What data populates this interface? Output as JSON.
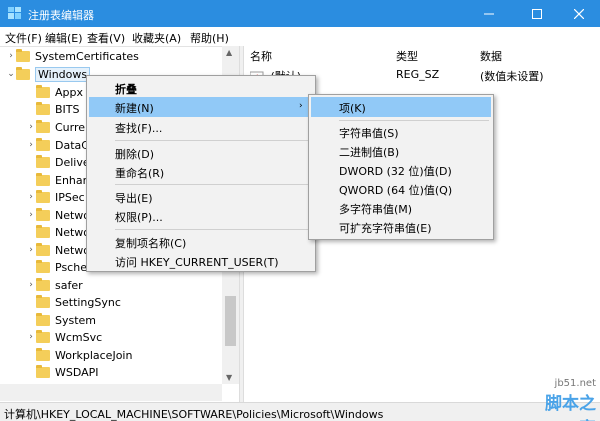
{
  "window": {
    "title": "注册表编辑器",
    "accent_color": "#2b8de0",
    "icons": {
      "app": "regedit-icon",
      "minimize": "minimize-icon",
      "maximize": "maximize-icon",
      "close": "close-icon"
    }
  },
  "menubar": {
    "items": [
      {
        "label": "文件(F)"
      },
      {
        "label": "编辑(E)"
      },
      {
        "label": "查看(V)"
      },
      {
        "label": "收藏夹(A)"
      },
      {
        "label": "帮助(H)"
      }
    ]
  },
  "tree": {
    "items": [
      {
        "label": "SystemCertificates",
        "expander": "›",
        "icon": "folder-icon"
      },
      {
        "label": "Windows",
        "expander": "⌄",
        "icon": "folder-icon",
        "selected": true
      },
      {
        "label": "Appx",
        "icon": "folder-icon"
      },
      {
        "label": "BITS",
        "icon": "folder-icon"
      },
      {
        "label": "Curre",
        "expander": "›",
        "icon": "folder-icon"
      },
      {
        "label": "DataC",
        "expander": "›",
        "icon": "folder-icon"
      },
      {
        "label": "Delive",
        "icon": "folder-icon"
      },
      {
        "label": "Enhar",
        "icon": "folder-icon"
      },
      {
        "label": "IPSec",
        "expander": "›",
        "icon": "folder-icon"
      },
      {
        "label": "Netwo",
        "expander": "›",
        "icon": "folder-icon"
      },
      {
        "label": "Netwo",
        "icon": "folder-icon"
      },
      {
        "label": "Netwo",
        "expander": "›",
        "icon": "folder-icon"
      },
      {
        "label": "Psche",
        "icon": "folder-icon"
      },
      {
        "label": "safer",
        "expander": "›",
        "icon": "folder-icon"
      },
      {
        "label": "SettingSync",
        "icon": "folder-icon"
      },
      {
        "label": "System",
        "icon": "folder-icon"
      },
      {
        "label": "WcmSvc",
        "expander": "›",
        "icon": "folder-icon"
      },
      {
        "label": "WorkplaceJoin",
        "icon": "folder-icon"
      },
      {
        "label": "WSDAPI",
        "icon": "folder-icon"
      }
    ]
  },
  "list": {
    "columns": [
      "名称",
      "类型",
      "数据"
    ],
    "rows": [
      {
        "name": "(默认)",
        "type": "REG_SZ",
        "data": "(数值未设置)",
        "icon": "string-value-icon"
      }
    ]
  },
  "context_menu": {
    "items": [
      {
        "label": "折叠"
      },
      {
        "label": "新建(N)",
        "submenu_arrow": "›"
      },
      {
        "label": "查找(F)..."
      },
      {
        "label": "删除(D)"
      },
      {
        "label": "重命名(R)"
      },
      {
        "label": "导出(E)"
      },
      {
        "label": "权限(P)..."
      },
      {
        "label": "复制项名称(C)"
      },
      {
        "label": "访问 HKEY_CURRENT_USER(T)"
      }
    ]
  },
  "submenu": {
    "items": [
      {
        "label": "项(K)"
      },
      {
        "label": "字符串值(S)"
      },
      {
        "label": "二进制值(B)"
      },
      {
        "label": "DWORD (32 位)值(D)"
      },
      {
        "label": "QWORD (64 位)值(Q)"
      },
      {
        "label": "多字符串值(M)"
      },
      {
        "label": "可扩充字符串值(E)"
      }
    ]
  },
  "statusbar": {
    "path": "计算机\\HKEY_LOCAL_MACHINE\\SOFTWARE\\Policies\\Microsoft\\Windows"
  },
  "watermark": {
    "site": "jb51.net",
    "text": "脚本之家"
  }
}
